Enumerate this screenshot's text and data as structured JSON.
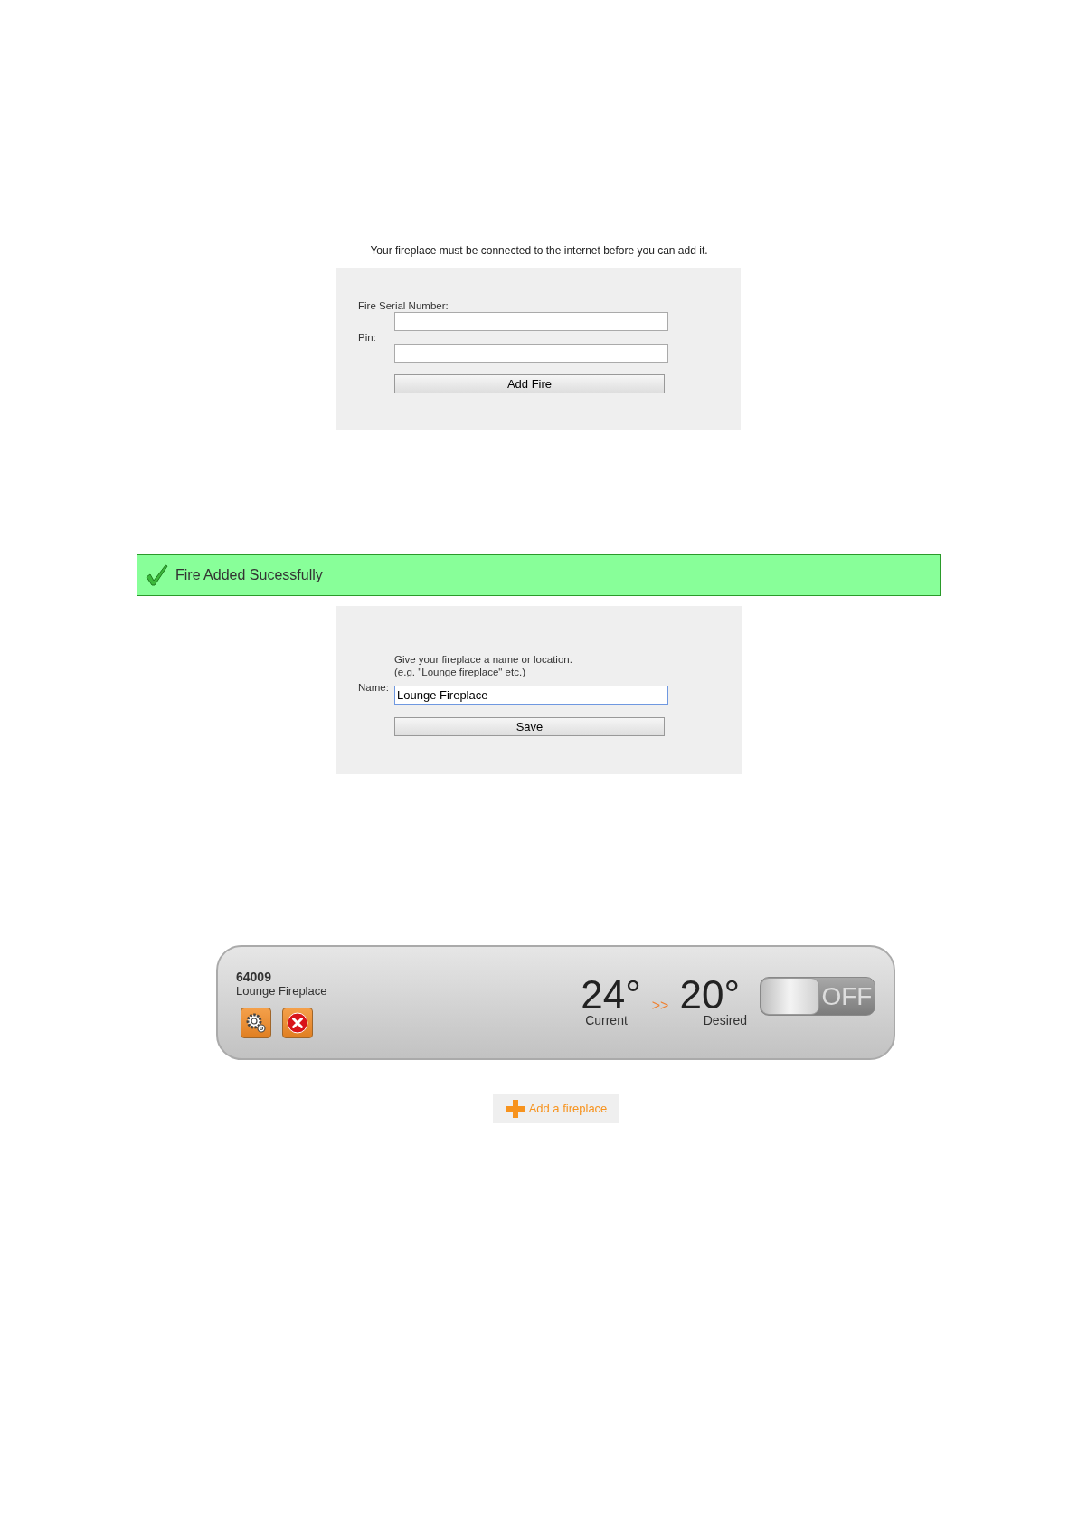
{
  "add_form": {
    "intro": "Your fireplace must be connected to the internet before you can add it.",
    "fields": [
      {
        "label": "Fire Serial Number:"
      },
      {
        "label": "Pin:"
      }
    ],
    "button": "Add Fire"
  },
  "banner": {
    "text": "Fire Added Sucessfully"
  },
  "name_form": {
    "label": "Name:",
    "hint_lines": [
      "Give your fireplace a name or location.",
      "(e.g. \"Lounge fireplace\" etc.)"
    ],
    "value": "Lounge Fireplace",
    "focused": true,
    "button": "Save"
  },
  "fireplace_card": {
    "id": "64009",
    "name": "Lounge Fireplace",
    "current_temp": "24°",
    "current_label": "Current",
    "separator": ">>",
    "desired_temp": "20°",
    "desired_label": "Desired",
    "on": false,
    "state_label": "OFF"
  },
  "add_button": "Add a fireplace"
}
